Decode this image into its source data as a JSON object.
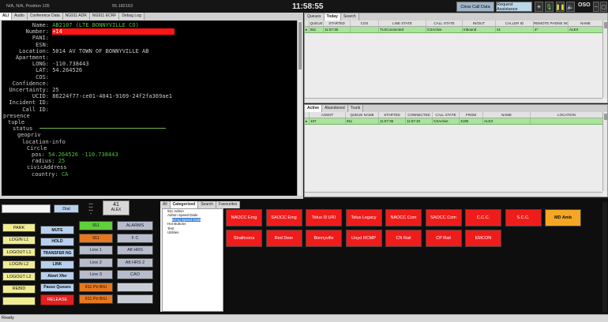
{
  "titlebar": {
    "position": "N/A, N/A, Position 105",
    "extension": "55.182163",
    "clock": "11:58:55",
    "clear_call_data": "Clear Call Data",
    "request_assistance": "Request Assistance",
    "logo": "OSO"
  },
  "left_tabs": [
    "ALI",
    "Audio",
    "Conference Data",
    "NG911 ADR",
    "NG911 ECRF",
    "Debug Log"
  ],
  "ali": {
    "rows": [
      {
        "label": "Name:",
        "value": "AB2107 (LTE BONNYVILLE CO)",
        "style": "green"
      },
      {
        "label": "Number:",
        "value": "+14",
        "style": "red"
      },
      {
        "label": "PANI:",
        "value": "",
        "style": ""
      },
      {
        "label": "ESN:",
        "value": "",
        "style": ""
      },
      {
        "label": "Location:",
        "value": "5014 AV TOWN OF BONNYVILLE AB",
        "style": ""
      },
      {
        "label": "Apartment:",
        "value": "",
        "style": ""
      },
      {
        "label": "LONG:",
        "value": "-110.738443",
        "style": ""
      },
      {
        "label": "LAT:",
        "value": "54.264526",
        "style": ""
      },
      {
        "label": "COS:",
        "value": "",
        "style": ""
      },
      {
        "label": "Confidence:",
        "value": "",
        "style": ""
      },
      {
        "label": "Uncertainty:",
        "value": "25",
        "style": ""
      },
      {
        "label": "UCID:",
        "value": "86224f77-ce01-4041-9169-24f2fa369ae1",
        "style": ""
      },
      {
        "label": "Incident ID:",
        "value": "",
        "style": ""
      },
      {
        "label": "Call ID:",
        "value": "",
        "style": ""
      }
    ],
    "xml_lines": [
      {
        "indent": 0,
        "text": "presence",
        "value": ""
      },
      {
        "indent": 1,
        "text": "tuple",
        "value": ""
      },
      {
        "indent": 2,
        "text": "status",
        "value": ""
      },
      {
        "indent": 3,
        "text": "geopriv",
        "value": ""
      },
      {
        "indent": 4,
        "text": "location-info",
        "value": ""
      },
      {
        "indent": 5,
        "text": "Circle",
        "value": ""
      },
      {
        "indent": 6,
        "text": "pos:",
        "value": "54.264526 -110.738443"
      },
      {
        "indent": 6,
        "text": "radius:",
        "value": "25"
      },
      {
        "indent": 5,
        "text": "civicAddress",
        "value": ""
      },
      {
        "indent": 6,
        "text": "country:",
        "value": "CA"
      }
    ]
  },
  "queue_panel": {
    "tabs": [
      "Queues",
      "Today",
      "Search"
    ],
    "columns": [
      "QUEUE",
      "STARTED",
      "COS",
      "LINE STATE",
      "CALL STATE",
      "IN/OUT",
      "CALLER ID",
      "REMOTE PHONE NO",
      "NAME"
    ],
    "rows": [
      [
        "911",
        "11:57:36",
        "",
        "TLSConnected",
        "CSActive",
        "Inbound",
        "41",
        "4*",
        "ALEX"
      ]
    ]
  },
  "active_panel": {
    "tabs": [
      "Active",
      "Abandoned",
      "Trunk"
    ],
    "columns": [
      "AGENT",
      "QUEUE NAME",
      "STARTED",
      "CONNECTED",
      "CALL STATE",
      "FROM",
      "NAME",
      "LOCATION"
    ],
    "rows": [
      [
        "107",
        "911",
        "11:57:36",
        "11:57:40",
        "CSActive",
        "418E",
        "ALEX",
        ""
      ]
    ]
  },
  "dial": {
    "button": "Dial",
    "info_number": "41",
    "info_name": "ALEX"
  },
  "agent_buttons": [
    "PARK",
    "LOGIN L1",
    "LOGOUT L1",
    "LOGIN L2",
    "LOGOUT L2",
    "REBID"
  ],
  "call_buttons": [
    "MUTE",
    "HOLD",
    "TRANSFER NG",
    "LINK",
    "Abort Xfer",
    "Pause Queues",
    "RELEASE"
  ],
  "line_buttons": [
    "911",
    "911",
    "Line 1",
    "Line 2",
    "Line 3",
    "911 Pri B/U",
    "911 Pri B/U"
  ],
  "aux_buttons": [
    "ALARMS",
    "F C",
    "Aft HRS",
    "Aft HRS 2",
    "CAO",
    "",
    ""
  ],
  "speed_tabs": [
    "All",
    "Categorized",
    "Search",
    "Favourites"
  ],
  "categories": [
    "911 Admin",
    "Admin Speed Dials",
    "Emrg Speed Dials",
    "Hot Buttons",
    "Test",
    "Utilities"
  ],
  "selected_category": "Emrg Speed Dials",
  "speed_dials_row1": [
    "NAOCC Emg",
    "SAOCC Emg",
    "Telus I3 URI",
    "Telus Legacy",
    "NAOCC Com",
    "SAOCC Com",
    "C.C.C.",
    "S.C.C.",
    "MD Amb"
  ],
  "speed_dials_row2": [
    "Strathcona",
    "Red Deer",
    "Bonnyville",
    "Lloyd RCMP",
    "CN Rail",
    "CP Rail",
    "EMCON"
  ],
  "status": "Ready"
}
